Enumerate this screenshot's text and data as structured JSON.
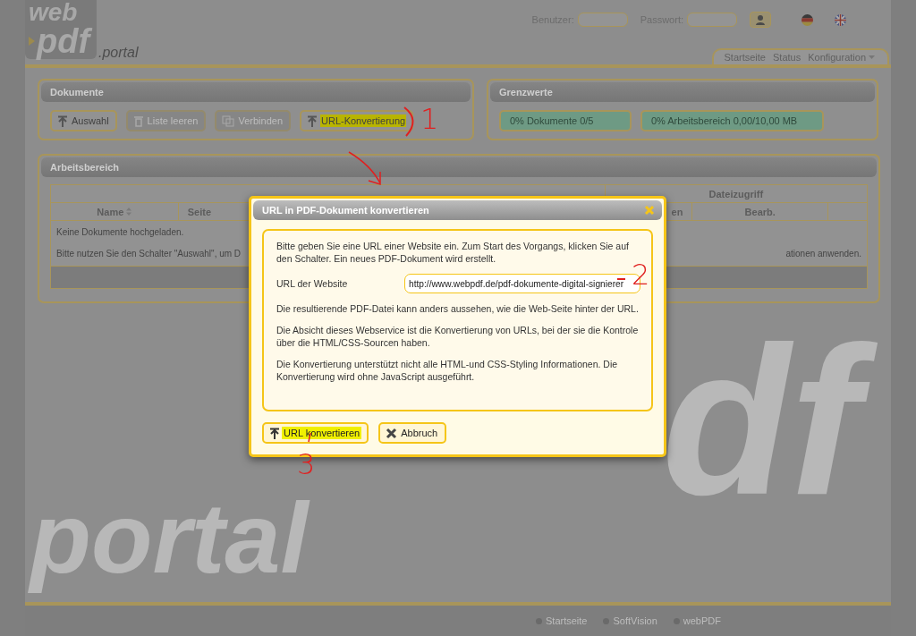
{
  "header": {
    "logo": {
      "top": "web",
      "main": "pdf",
      "suffix": ".portal"
    },
    "login": {
      "user_label": "Benutzer:",
      "password_label": "Passwort:"
    },
    "languages": [
      {
        "kind": "de"
      },
      {
        "kind": "en"
      }
    ]
  },
  "nav": [
    {
      "label": "Startseite",
      "dropdown": false
    },
    {
      "label": "Status",
      "dropdown": false
    },
    {
      "label": "Konfiguration",
      "dropdown": true
    }
  ],
  "documents_panel": {
    "title": "Dokumente",
    "buttons": [
      {
        "label": "Auswahl",
        "disabled": false,
        "highlighted": false
      },
      {
        "label": "Liste leeren",
        "disabled": true,
        "highlighted": false
      },
      {
        "label": "Verbinden",
        "disabled": true,
        "highlighted": false
      },
      {
        "label": "URL-Konvertierung",
        "disabled": false,
        "highlighted": true
      }
    ]
  },
  "limits_panel": {
    "title": "Grenzwerte",
    "meters": [
      "0% Dokumente 0/5",
      "0% Arbeitsbereich 0,00/10,00 MB"
    ]
  },
  "workspace_panel": {
    "title": "Arbeitsbereich",
    "table": {
      "group_header": "Dateizugriff",
      "columns": [
        "Name",
        "Seite",
        "en",
        "Bearb."
      ],
      "rows": [
        {
          "left": "Keine Dokumente hochgeladen."
        },
        {
          "left": "Bitte nutzen Sie den Schalter \"Auswahl\", um D",
          "right": "ationen anwenden."
        }
      ]
    }
  },
  "background_wordmark": {
    "top": "df",
    "bottom": "portal"
  },
  "dialog": {
    "title": "URL in PDF-Dokument konvertieren",
    "intro": "Bitte geben Sie eine URL einer Website ein. Zum Start des Vorgangs, klicken Sie auf den Schalter. Ein neues PDF-Dokument wird erstellt.",
    "url_label": "URL der Website",
    "url_value": "http://www.webpdf.de/pdf-dokumente-digital-signierer",
    "notes": [
      "Die resultierende PDF-Datei kann anders aussehen, wie die Web-Seite hinter der URL.",
      "Die Absicht dieses Webservice ist die Konvertierung von URLs, bei der sie die Kontrole über die HTML/CSS-Sourcen haben.",
      "Die Konvertierung unterstützt nicht alle HTML-und CSS-Styling Informationen. Die Konvertierung wird ohne JavaScript ausgeführt."
    ],
    "buttons": [
      {
        "label": "URL konvertieren",
        "highlighted": true
      },
      {
        "label": "Abbruch",
        "highlighted": false
      }
    ]
  },
  "annotations": [
    "1",
    "2",
    "3"
  ],
  "footer": {
    "links": [
      "Startseite",
      "SoftVision",
      "webPDF"
    ]
  }
}
